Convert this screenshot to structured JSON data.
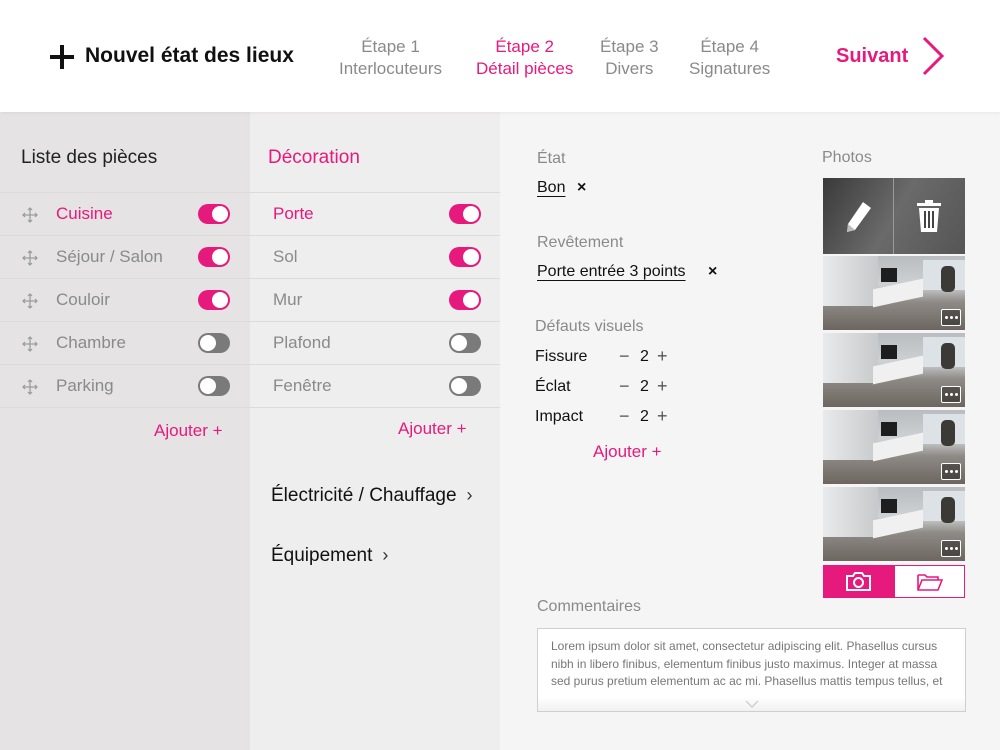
{
  "header": {
    "title": "Nouvel état des lieux",
    "steps": [
      {
        "number": "Étape 1",
        "name": "Interlocuteurs",
        "active": false
      },
      {
        "number": "Étape 2",
        "name": "Détail pièces",
        "active": true
      },
      {
        "number": "Étape 3",
        "name": "Divers",
        "active": false
      },
      {
        "number": "Étape 4",
        "name": "Signatures",
        "active": false
      }
    ],
    "next_label": "Suivant"
  },
  "rooms": {
    "title": "Liste des pièces",
    "items": [
      {
        "label": "Cuisine",
        "enabled": true,
        "selected": true
      },
      {
        "label": "Séjour / Salon",
        "enabled": true,
        "selected": false
      },
      {
        "label": "Couloir",
        "enabled": true,
        "selected": false
      },
      {
        "label": "Chambre",
        "enabled": false,
        "selected": false
      },
      {
        "label": "Parking",
        "enabled": false,
        "selected": false
      }
    ],
    "add_label": "Ajouter +"
  },
  "categories": {
    "title": "Décoration",
    "items": [
      {
        "label": "Porte",
        "enabled": true,
        "selected": true
      },
      {
        "label": "Sol",
        "enabled": true,
        "selected": false
      },
      {
        "label": "Mur",
        "enabled": true,
        "selected": false
      },
      {
        "label": "Plafond",
        "enabled": false,
        "selected": false
      },
      {
        "label": "Fenêtre",
        "enabled": false,
        "selected": false
      }
    ],
    "add_label": "Ajouter +",
    "sections": [
      "Électricité / Chauffage",
      "Équipement"
    ]
  },
  "detail": {
    "state_label": "État",
    "state_value": "Bon",
    "covering_label": "Revêtement",
    "covering_value": "Porte entrée 3 points",
    "defects_label": "Défauts visuels",
    "defects": [
      {
        "name": "Fissure",
        "count": "2"
      },
      {
        "name": "Éclat",
        "count": "2"
      },
      {
        "name": "Impact",
        "count": "2"
      }
    ],
    "add_label": "Ajouter +",
    "photos_label": "Photos",
    "photo_count": 4,
    "comments_label": "Commentaires",
    "comments_text": "Lorem ipsum dolor sit amet, consectetur adipiscing elit. Phasellus cursus nibh in libero finibus, elementum finibus justo maximus. Integer at massa sed purus pretium elementum ac ac mi. Phasellus mattis tempus tellus, et"
  },
  "colors": {
    "accent": "#e6197d",
    "toggle_off": "#7a7a7a"
  }
}
